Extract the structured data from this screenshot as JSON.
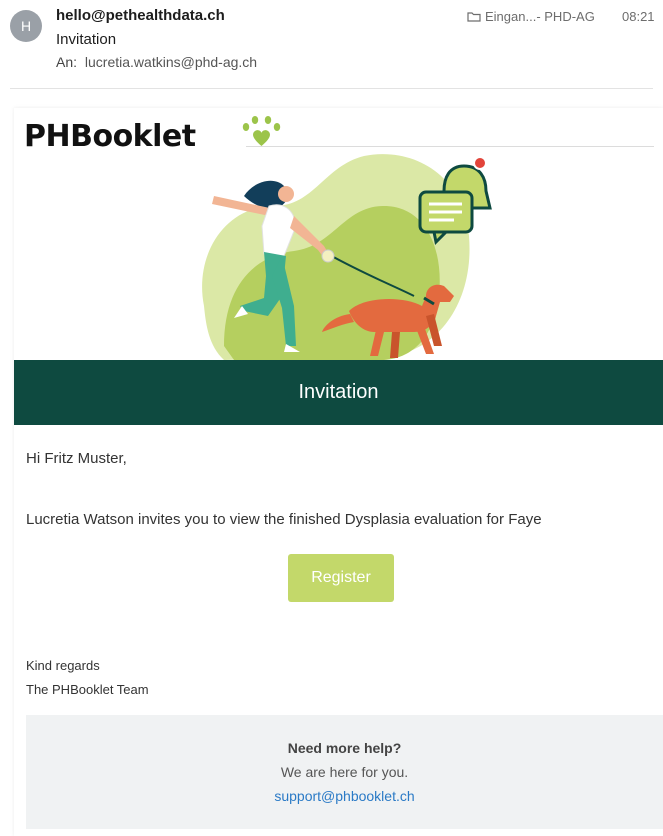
{
  "mail": {
    "avatar_letter": "H",
    "sender": "hello@pethealthdata.ch",
    "subject": "Invitation",
    "recipient_label": "An:",
    "recipient": "lucretia.watkins@phd-ag.ch",
    "folder": "Eingan...- PHD-AG",
    "time": "08:21"
  },
  "email": {
    "logo_text": "PHBooklet",
    "banner_title": "Invitation",
    "greeting": "Hi Fritz Muster,",
    "message": "Lucretia Watson invites you to view the finished Dysplasia evaluation for Faye",
    "register_label": "Register",
    "closing_line1": "Kind regards",
    "closing_line2": "The PHBooklet Team",
    "help": {
      "title": "Need more help?",
      "subtitle": "We are here for you.",
      "link": "support@phbooklet.ch"
    }
  },
  "colors": {
    "banner": "#0e4a40",
    "accent_green": "#c3d86a",
    "link": "#2a7ac6"
  }
}
